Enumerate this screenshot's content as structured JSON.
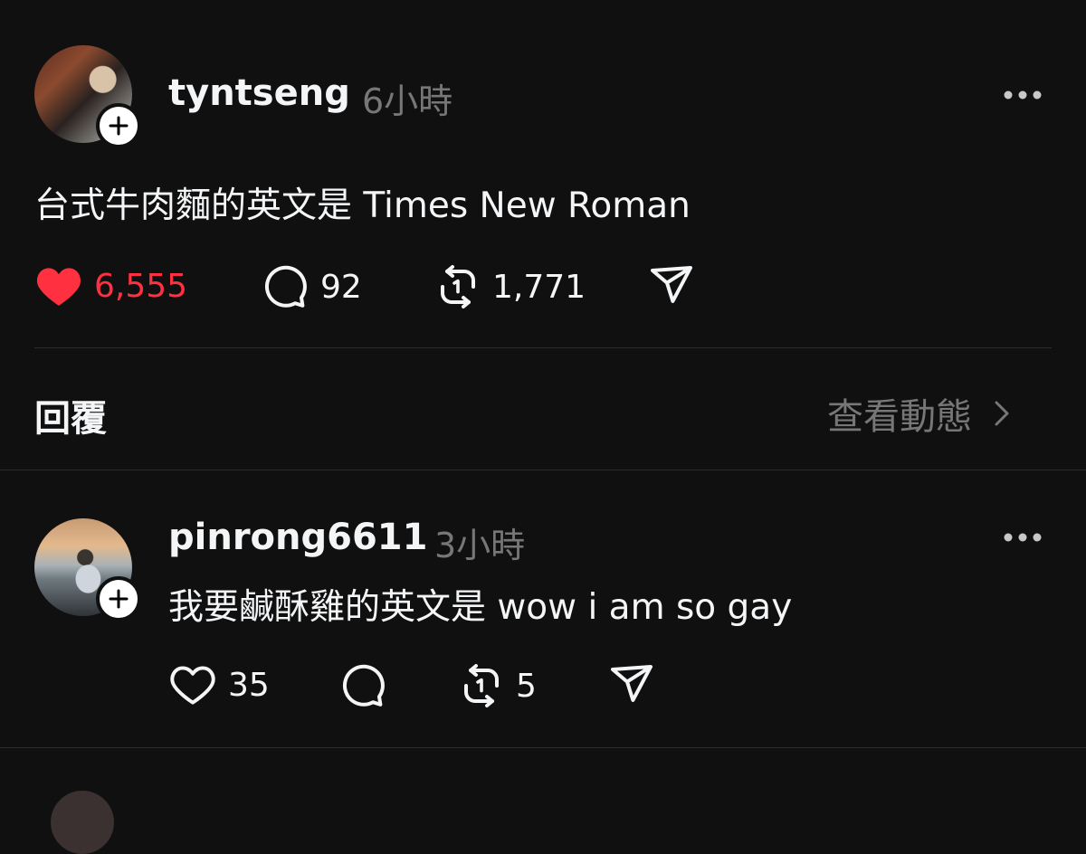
{
  "post": {
    "username": "tyntseng",
    "time": "6小時",
    "text": "台式牛肉麵的英文是 Times New Roman",
    "likes": "6,555",
    "comments": "92",
    "reposts": "1,771",
    "liked": true,
    "like_color": "#ff3040"
  },
  "replies_header": {
    "label": "回覆",
    "view_activity": "查看動態"
  },
  "reply": {
    "username": "pinrong6611",
    "time": "3小時",
    "text": "我要鹹酥雞的英文是 wow i am so gay",
    "likes": "35",
    "comments": "",
    "reposts": "5"
  },
  "icons": [
    "more-icon",
    "heart-icon",
    "comment-icon",
    "repost-icon",
    "share-icon",
    "plus-icon",
    "chevron-right-icon"
  ]
}
